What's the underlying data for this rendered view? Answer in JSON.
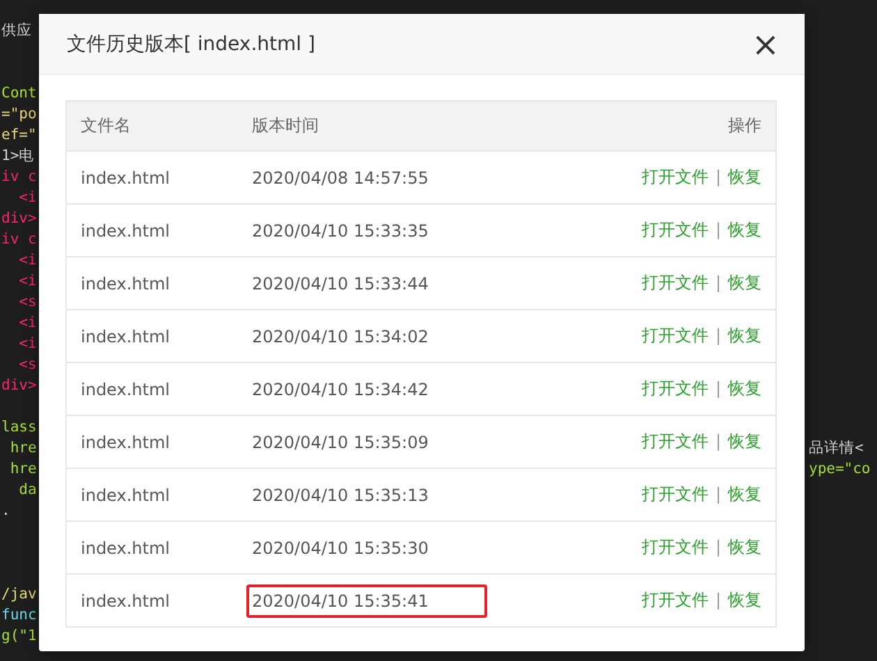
{
  "editor": {
    "lines": [
      {
        "kind": "code",
        "left": "供应",
        "color": "#d4d4d4"
      },
      {
        "kind": "blank"
      },
      {
        "kind": "blank"
      },
      {
        "kind": "code",
        "left": "Cont",
        "color": "#a6e22e"
      },
      {
        "kind": "code",
        "left": "=\"po",
        "color": "#e6db74"
      },
      {
        "kind": "code",
        "left": "ef=\"",
        "color": "#e6db74"
      },
      {
        "kind": "code",
        "left": "1>电",
        "color": "#d4d4d4"
      },
      {
        "kind": "code",
        "left": "iv c",
        "color": "#f92672"
      },
      {
        "kind": "code",
        "left": "  <i",
        "color": "#f92672"
      },
      {
        "kind": "code",
        "left": "div>",
        "color": "#f92672"
      },
      {
        "kind": "code",
        "left": "iv c",
        "color": "#f92672"
      },
      {
        "kind": "code",
        "left": "  <i",
        "color": "#f92672"
      },
      {
        "kind": "code",
        "left": "  <i",
        "color": "#f92672"
      },
      {
        "kind": "code",
        "left": "  <s",
        "color": "#f92672"
      },
      {
        "kind": "code",
        "left": "  <i",
        "color": "#f92672"
      },
      {
        "kind": "code",
        "left": "  <i",
        "color": "#f92672"
      },
      {
        "kind": "code",
        "left": "  <s",
        "color": "#f92672"
      },
      {
        "kind": "code",
        "left": "div>",
        "color": "#f92672"
      },
      {
        "kind": "blank"
      },
      {
        "kind": "code",
        "left": "lass",
        "color": "#a6e22e"
      },
      {
        "kind": "code",
        "left": " hre",
        "color": "#a6e22e",
        "right": {
          "text": "品详情<",
          "color": "#d4d4d4"
        }
      },
      {
        "kind": "code",
        "left": " hre",
        "color": "#a6e22e",
        "right": {
          "text": "ype=\"co",
          "color": "#a6e22e"
        }
      },
      {
        "kind": "code",
        "left": "  da",
        "color": "#a6e22e"
      },
      {
        "kind": "code",
        "left": ".",
        "color": "#d4d4d4"
      },
      {
        "kind": "blank"
      },
      {
        "kind": "blank"
      },
      {
        "kind": "blank"
      },
      {
        "kind": "code",
        "left": "/jav",
        "color": "#e6db74"
      },
      {
        "kind": "code",
        "left": "func",
        "color": "#66d9ef"
      },
      {
        "kind": "code",
        "left": "g(\"1",
        "color": "#a6e22e"
      }
    ]
  },
  "dialog": {
    "title": "文件历史版本[ index.html ]",
    "close": "×",
    "columns": [
      "文件名",
      "版本时间",
      "操作"
    ],
    "rows": [
      {
        "file": "index.html",
        "time": "2020/04/08 14:57:55",
        "open": "打开文件",
        "separator": "|",
        "restore": "恢复",
        "highlighted": false
      },
      {
        "file": "index.html",
        "time": "2020/04/10 15:33:35",
        "open": "打开文件",
        "separator": "|",
        "restore": "恢复",
        "highlighted": false
      },
      {
        "file": "index.html",
        "time": "2020/04/10 15:33:44",
        "open": "打开文件",
        "separator": "|",
        "restore": "恢复",
        "highlighted": false
      },
      {
        "file": "index.html",
        "time": "2020/04/10 15:34:02",
        "open": "打开文件",
        "separator": "|",
        "restore": "恢复",
        "highlighted": false
      },
      {
        "file": "index.html",
        "time": "2020/04/10 15:34:42",
        "open": "打开文件",
        "separator": "|",
        "restore": "恢复",
        "highlighted": false
      },
      {
        "file": "index.html",
        "time": "2020/04/10 15:35:09",
        "open": "打开文件",
        "separator": "|",
        "restore": "恢复",
        "highlighted": false
      },
      {
        "file": "index.html",
        "time": "2020/04/10 15:35:13",
        "open": "打开文件",
        "separator": "|",
        "restore": "恢复",
        "highlighted": false
      },
      {
        "file": "index.html",
        "time": "2020/04/10 15:35:30",
        "open": "打开文件",
        "separator": "|",
        "restore": "恢复",
        "highlighted": false
      },
      {
        "file": "index.html",
        "time": "2020/04/10 15:35:41",
        "open": "打开文件",
        "separator": "|",
        "restore": "恢复",
        "highlighted": true
      }
    ]
  }
}
